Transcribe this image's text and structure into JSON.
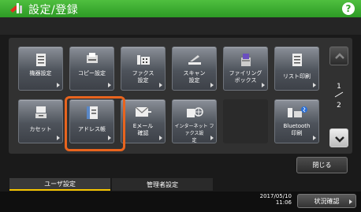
{
  "header": {
    "title": "設定/登録",
    "help_label": "?"
  },
  "tiles": [
    {
      "label": "機器設定"
    },
    {
      "label": "コピー設定"
    },
    {
      "label": "ファクス\n設定"
    },
    {
      "label": "スキャン\n設定"
    },
    {
      "label": "ファイリング\nボックス"
    },
    {
      "label": "リスト印刷"
    },
    {
      "label": "カセット"
    },
    {
      "label": "アドレス帳"
    },
    {
      "label": "Eメール\n確認"
    },
    {
      "label": "インターネット ファクス設\n定"
    },
    {
      "label": "Bluetooth\n印刷"
    }
  ],
  "pager": {
    "current": "1",
    "total": "2"
  },
  "close_label": "閉じる",
  "tabs": [
    {
      "label": "ユーザ設定",
      "active": true
    },
    {
      "label": "管理者設定",
      "active": false
    }
  ],
  "status": {
    "date": "2017/05/10",
    "time": "11:06",
    "button_label": "状況確認"
  },
  "colors": {
    "title_bar": "#3aa52e",
    "highlight": "#e8641e",
    "tab_active_underline": "#f5c500"
  }
}
